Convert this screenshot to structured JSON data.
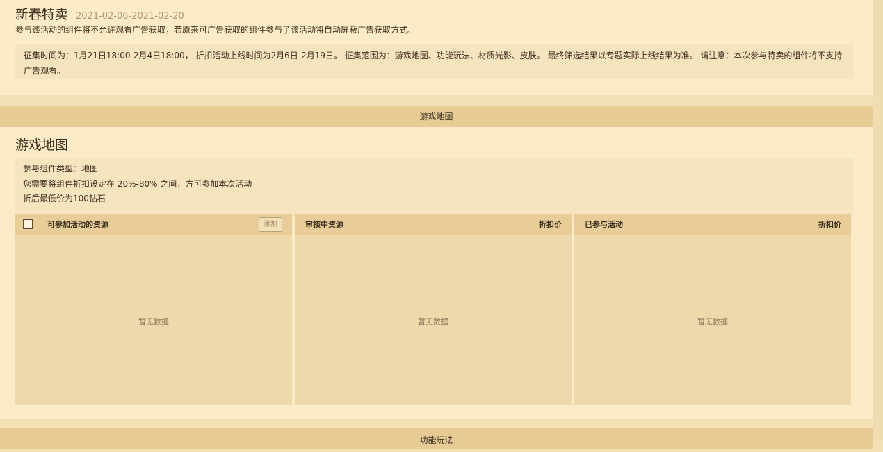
{
  "header": {
    "title": "新春特卖",
    "date_range": "2021-02-06-2021-02-20",
    "notice": "参与该活动的组件将不允许观看广告获取，若原来可广告获取的组件参与了该活动将自动屏蔽广告获取方式。",
    "info": "征集时间为：1月21日18:00-2月4日18:00， 折扣活动上线时间为2月6日-2月19日。 征集范围为：游戏地图、功能玩法、材质光影、皮肤。 最终筛选结果以专题实际上线结果为准。 请注意：本次参与特卖的组件将不支持广告观看。"
  },
  "sections": [
    {
      "tab_label": "游戏地图",
      "title": "游戏地图",
      "rules": [
        "参与组件类型：地图",
        "您需要将组件折扣设定在 20%-80% 之间，方可参加本次活动",
        "折后最低价为100钻石"
      ],
      "columns": [
        {
          "title": "可参加活动的资源",
          "action": "添加",
          "empty": "暂无数据"
        },
        {
          "title": "审核中资源",
          "right_label": "折扣价",
          "empty": "暂无数据"
        },
        {
          "title": "已参与活动",
          "right_label": "折扣价",
          "empty": "暂无数据"
        }
      ]
    },
    {
      "tab_label": "功能玩法"
    }
  ]
}
